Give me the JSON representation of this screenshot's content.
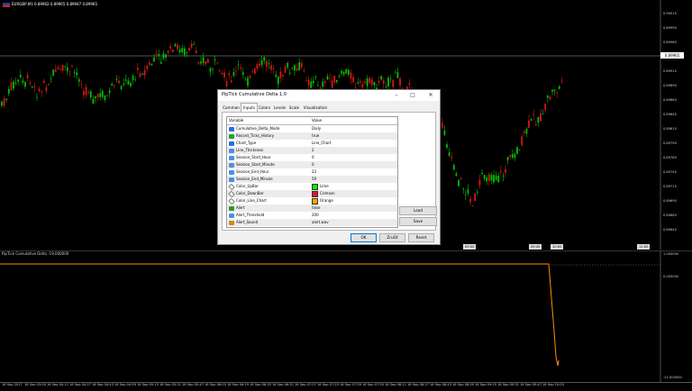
{
  "chart": {
    "symbol_label": "EURGBP,M1  0.89962 0.89965 0.89947 0.89965",
    "current_price": "0.89965",
    "price_ticks": [
      "0.90015",
      "0.89990",
      "0.89965",
      "0.89940",
      "0.89915",
      "0.89890",
      "0.89865",
      "0.89840",
      "0.89815",
      "0.89790",
      "0.89765",
      "0.89740",
      "0.89715",
      "0.89690",
      "0.89665",
      "0.89640"
    ],
    "hm_badges": [
      "09:00",
      "09:45",
      "10:00",
      "11:00"
    ],
    "colors": {
      "up": "#00c000",
      "down": "#d01818",
      "grid": "#444444"
    }
  },
  "indicator": {
    "label": "PipTick Cumulative Delta  -19.000000",
    "top_value": "0.000000",
    "max_value": "1.000000",
    "min_value": "-21.000000",
    "line_color": "#ff8c00"
  },
  "dates": [
    "16 Sep 2017",
    "16 Sep 03:00",
    "16 Sep 04:11",
    "16 Sep 04:27",
    "16 Sep 04:43",
    "16 Sep 04:59",
    "16 Sep 05:15",
    "16 Sep 05:31",
    "16 Sep 05:47",
    "16 Sep 06:03",
    "16 Sep 06:19",
    "16 Sep 06:35",
    "16 Sep 06:51",
    "16 Sep 07:07",
    "16 Sep 07:23",
    "16 Sep 07:39",
    "16 Sep 07:55",
    "16 Sep 08:11",
    "16 Sep 08:27",
    "16 Sep 08:43",
    "16 Sep 08:59",
    "16 Sep 09:15",
    "16 Sep 09:31",
    "16 Sep 09:47",
    "16 Sep 10:03"
  ],
  "dialog": {
    "title": "PipTick Cumulative Delta 1.0",
    "tabs": [
      "Common",
      "Inputs",
      "Colors",
      "Levels",
      "Scale",
      "Visualization"
    ],
    "active_tab": "Inputs",
    "columns": [
      "Variable",
      "Value"
    ],
    "params": [
      {
        "icon": "enum-icon",
        "name": "Cumulative_Delta_Mode",
        "value": "Daily"
      },
      {
        "icon": "bool-icon",
        "name": "Record_Ticks_History",
        "value": "true"
      },
      {
        "icon": "enum-icon",
        "name": "Chart_Type",
        "value": "Line_Chart"
      },
      {
        "icon": "int-icon",
        "name": "Line_Thickness",
        "value": "2"
      },
      {
        "icon": "int-icon",
        "name": "Session_Start_Hour",
        "value": "0"
      },
      {
        "icon": "int-icon",
        "name": "Session_Start_Minute",
        "value": "0"
      },
      {
        "icon": "int-icon",
        "name": "Session_End_Hour",
        "value": "23"
      },
      {
        "icon": "int-icon",
        "name": "Session_End_Minute",
        "value": "59"
      },
      {
        "icon": "color-icon",
        "name": "Color_UpBar",
        "value": "Lime",
        "swatch": "#00ff00"
      },
      {
        "icon": "color-icon",
        "name": "Color_DownBar",
        "value": "Crimson",
        "swatch": "#dc143c"
      },
      {
        "icon": "color-icon",
        "name": "Color_Line_Chart",
        "value": "Orange",
        "swatch": "#ffa500"
      },
      {
        "icon": "bool-icon",
        "name": "Alert",
        "value": "false"
      },
      {
        "icon": "int-icon",
        "name": "Alert_Threshold",
        "value": "200"
      },
      {
        "icon": "string-icon",
        "name": "Alert_Sound",
        "value": "alert.wav"
      }
    ],
    "load_label": "Load",
    "save_label": "Save",
    "ok_label": "OK",
    "cancel_label": "Zrušit",
    "reset_label": "Reset"
  }
}
